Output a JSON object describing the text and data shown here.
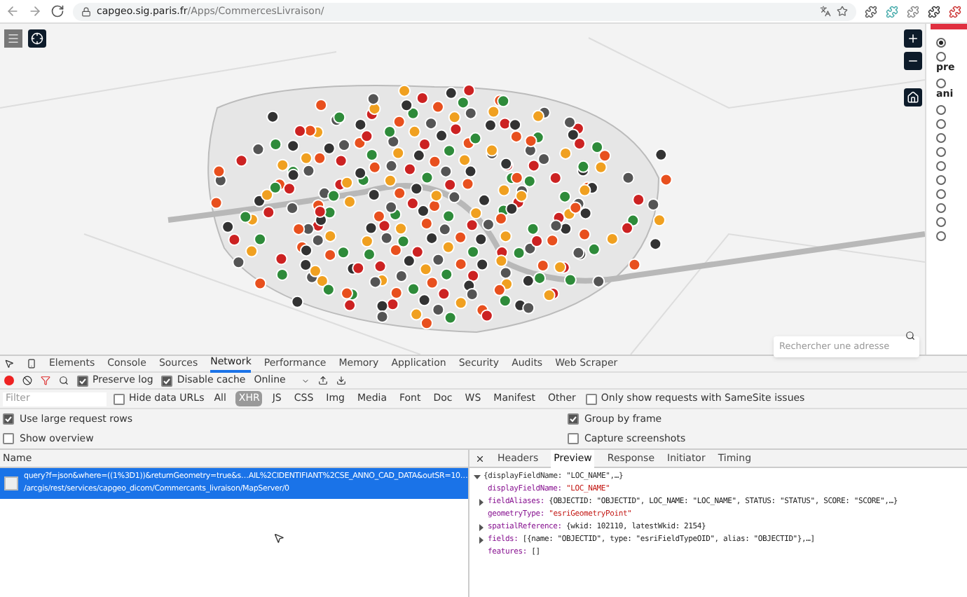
{
  "browser": {
    "url_host": "capgeo.sig.paris.fr",
    "url_path": "/Apps/CommercesLivraison/"
  },
  "map": {
    "search": {
      "placeholder": "Rechercher une adresse"
    }
  },
  "side_panel": {
    "items": [
      {
        "selected": true
      },
      {
        "label": "pre",
        "selected": false
      },
      {
        "label": "ani",
        "selected": false
      },
      {
        "selected": false
      },
      {
        "selected": false
      },
      {
        "selected": false
      },
      {
        "selected": false
      },
      {
        "selected": false
      },
      {
        "selected": false
      },
      {
        "selected": false
      },
      {
        "selected": false
      },
      {
        "selected": false
      },
      {
        "selected": false
      }
    ]
  },
  "devtools": {
    "tabs": [
      {
        "label": "Elements",
        "selected": false
      },
      {
        "label": "Console",
        "selected": false
      },
      {
        "label": "Sources",
        "selected": false
      },
      {
        "label": "Network",
        "selected": true
      },
      {
        "label": "Performance",
        "selected": false
      },
      {
        "label": "Memory",
        "selected": false
      },
      {
        "label": "Application",
        "selected": false
      },
      {
        "label": "Security",
        "selected": false
      },
      {
        "label": "Audits",
        "selected": false
      },
      {
        "label": "Web Scraper",
        "selected": false
      }
    ],
    "toolbar": {
      "recording": true,
      "preserve_log": {
        "label": "Preserve log",
        "checked": true
      },
      "disable_cache": {
        "label": "Disable cache",
        "checked": true
      },
      "throttling": "Online"
    },
    "filter": {
      "placeholder": "Filter",
      "hide_data_urls": {
        "label": "Hide data URLs",
        "checked": false
      },
      "types": [
        {
          "label": "All",
          "selected": false
        },
        {
          "label": "XHR",
          "selected": true
        },
        {
          "label": "JS",
          "selected": false
        },
        {
          "label": "CSS",
          "selected": false
        },
        {
          "label": "Img",
          "selected": false
        },
        {
          "label": "Media",
          "selected": false
        },
        {
          "label": "Font",
          "selected": false
        },
        {
          "label": "Doc",
          "selected": false
        },
        {
          "label": "WS",
          "selected": false
        },
        {
          "label": "Manifest",
          "selected": false
        },
        {
          "label": "Other",
          "selected": false
        }
      ],
      "samesite": {
        "label": "Only show requests with SameSite issues",
        "checked": false
      }
    },
    "options_left": [
      {
        "label": "Use large request rows",
        "checked": true
      },
      {
        "label": "Show overview",
        "checked": false
      }
    ],
    "options_right": [
      {
        "label": "Group by frame",
        "checked": true
      },
      {
        "label": "Capture screenshots",
        "checked": false
      }
    ],
    "requests": {
      "column": "Name",
      "rows": [
        {
          "name": "query?f=json&where=((1%3D1))&returnGeometry=true&s…AIL%2CIDENTIFIANT%2CSE_ANNO_CAD_DATA&outSR=10…",
          "path": "/arcgis/rest/services/capgeo_dicom/Commercants_livraison/MapServer/0",
          "selected": true
        }
      ]
    },
    "detail_tabs": [
      {
        "label": "Headers",
        "selected": false
      },
      {
        "label": "Preview",
        "selected": true
      },
      {
        "label": "Response",
        "selected": false
      },
      {
        "label": "Initiator",
        "selected": false
      },
      {
        "label": "Timing",
        "selected": false
      }
    ],
    "preview": {
      "summary": "{displayFieldName: \"LOC_NAME\",…}",
      "expanded": true,
      "children": [
        {
          "kind": "leaf",
          "key": "displayFieldName:",
          "value": "\"LOC_NAME\"",
          "color": "#c41a16"
        },
        {
          "kind": "node",
          "expanded": false,
          "key": "fieldAliases:",
          "value": "{OBJECTID: \"OBJECTID\", LOC_NAME: \"LOC_NAME\", STATUS: \"STATUS\", SCORE: \"SCORE\",…}"
        },
        {
          "kind": "leaf",
          "key": "geometryType:",
          "value": "\"esriGeometryPoint\"",
          "color": "#c41a16"
        },
        {
          "kind": "node",
          "expanded": false,
          "key": "spatialReference:",
          "value": "{wkid: 102110, latestWkid: 2154}"
        },
        {
          "kind": "node",
          "expanded": false,
          "key": "fields:",
          "value": "[{name: \"OBJECTID\", type: \"esriFieldTypeOID\", alias: \"OBJECTID\"},…]"
        },
        {
          "kind": "leaf",
          "key": "features:",
          "value": "[]"
        }
      ]
    }
  }
}
